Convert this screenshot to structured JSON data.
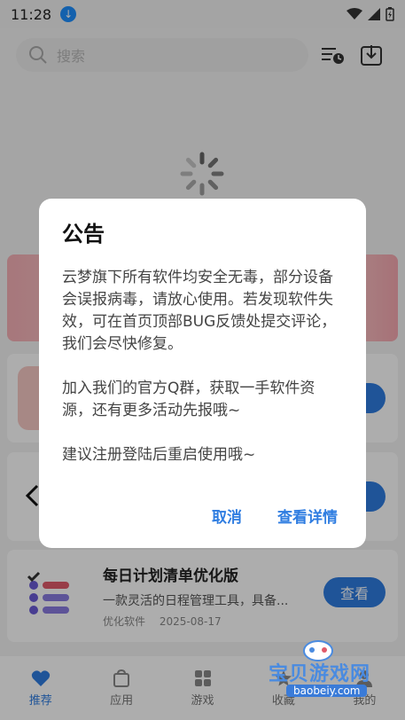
{
  "status_bar": {
    "time": "11:28"
  },
  "search": {
    "placeholder": "搜索"
  },
  "cards": [
    {
      "title": "",
      "desc": "",
      "button": ""
    },
    {
      "title": "",
      "desc": "",
      "button": ""
    },
    {
      "title": "每日计划清单优化版",
      "desc": "一款灵活的日程管理工具，具备...",
      "category": "优化软件",
      "date": "2025-08-17",
      "button": "查看"
    }
  ],
  "bottom_nav": [
    {
      "label": "推荐",
      "icon": "heart-icon"
    },
    {
      "label": "应用",
      "icon": "bag-icon"
    },
    {
      "label": "游戏",
      "icon": "grid-icon"
    },
    {
      "label": "收藏",
      "icon": "star-icon"
    },
    {
      "label": "我的",
      "icon": "user-icon"
    }
  ],
  "dialog": {
    "title": "公告",
    "body": "云梦旗下所有软件均安全无毒，部分设备会误报病毒，请放心使用。若发现软件失效，可在首页顶部BUG反馈处提交评论，我们会尽快修复。\n\n加入我们的官方Q群，获取一手软件资源，还有更多活动先报哦~\n\n建议注册登陆后重启使用哦~",
    "cancel": "取消",
    "details": "查看详情"
  },
  "watermark": {
    "text": "宝贝游戏网",
    "url": "baobeiy.com"
  },
  "colors": {
    "accent": "#2f7de1",
    "banner_pink": "#f6b0b6"
  }
}
